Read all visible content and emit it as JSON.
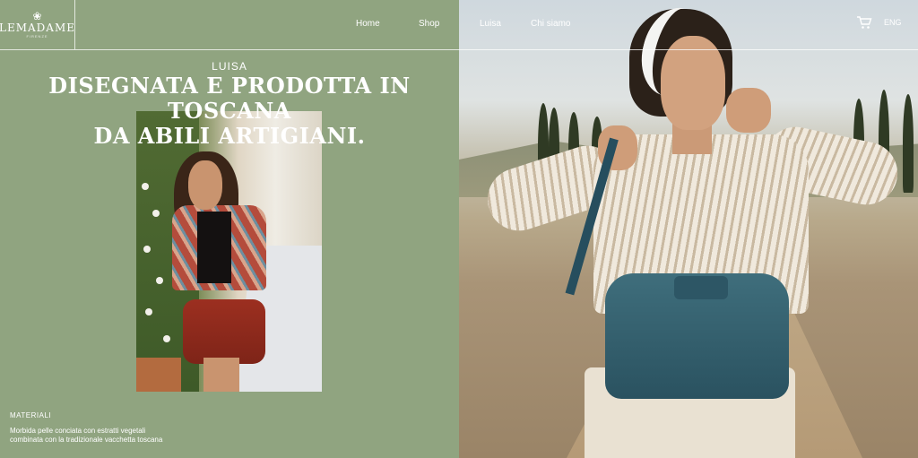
{
  "header": {
    "logo": {
      "name": "LEMADAME",
      "tagline": "FIRENZE"
    },
    "nav": [
      {
        "label": "Home"
      },
      {
        "label": "Shop"
      },
      {
        "label": "Luisa"
      },
      {
        "label": "Chi siamo"
      }
    ],
    "cart_icon": "cart-icon",
    "language": "ENG"
  },
  "hero": {
    "kicker": "LUISA",
    "headline_line1": "DISEGNATA E PRODOTTA IN TOSCANA",
    "headline_line2": "DA ABILI ARTIGIANI."
  },
  "materials": {
    "label": "MATERIALI",
    "text": "Morbida pelle conciata con estratti vegetali combinata con la tradizionale vacchetta toscana"
  },
  "colors": {
    "panel_green": "#90a480",
    "text": "#ffffff"
  }
}
